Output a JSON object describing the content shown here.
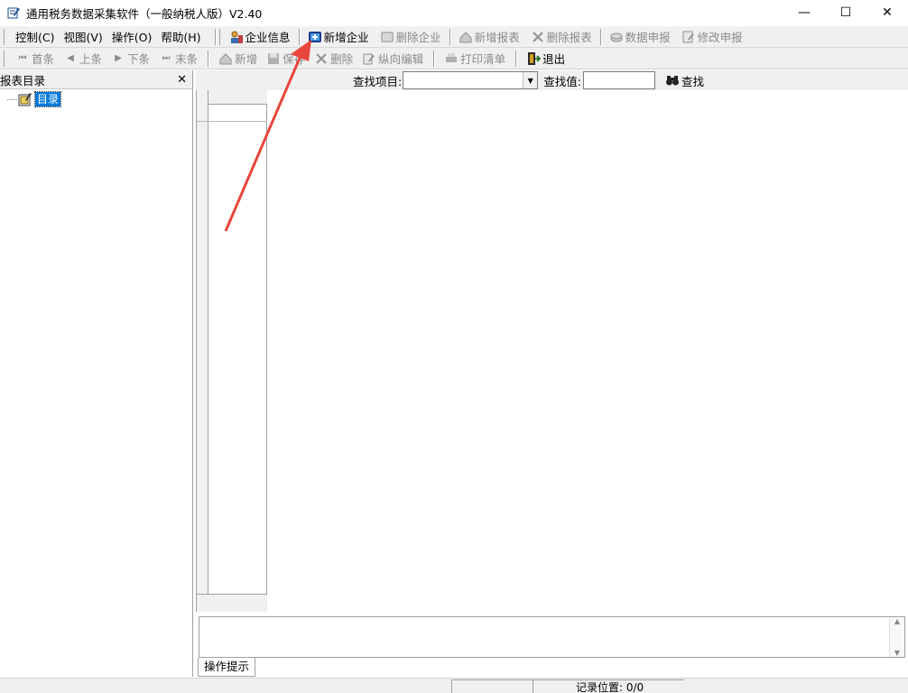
{
  "window": {
    "title": "通用税务数据采集软件（一般纳税人版）V2.40",
    "minimize": "—",
    "maximize": "☐",
    "close": "✕"
  },
  "menu": [
    {
      "label": "控制(C)"
    },
    {
      "label": "视图(V)"
    },
    {
      "label": "操作(O)"
    },
    {
      "label": "帮助(H)"
    }
  ],
  "toolbar1": [
    {
      "label": "企业信息",
      "icon": "enterprise-info-icon",
      "enabled": true
    },
    {
      "label": "新增企业",
      "icon": "add-enterprise-icon",
      "enabled": true
    },
    {
      "label": "删除企业",
      "icon": "delete-enterprise-icon",
      "enabled": false
    },
    {
      "label": "新增报表",
      "icon": "add-report-icon",
      "enabled": false
    },
    {
      "label": "删除报表",
      "icon": "delete-report-icon",
      "enabled": false
    },
    {
      "label": "数据申报",
      "icon": "declare-data-icon",
      "enabled": false
    },
    {
      "label": "修改申报",
      "icon": "modify-declare-icon",
      "enabled": false
    }
  ],
  "toolbar2": [
    {
      "label": "首条",
      "icon": "first-record-icon",
      "enabled": false
    },
    {
      "label": "上条",
      "icon": "prev-record-icon",
      "enabled": false
    },
    {
      "label": "下条",
      "icon": "next-record-icon",
      "enabled": false
    },
    {
      "label": "末条",
      "icon": "last-record-icon",
      "enabled": false
    },
    {
      "label": "新增",
      "icon": "add-icon",
      "enabled": false
    },
    {
      "label": "保存",
      "icon": "save-icon",
      "enabled": false
    },
    {
      "label": "删除",
      "icon": "delete-icon",
      "enabled": false
    },
    {
      "label": "纵向编辑",
      "icon": "vertical-edit-icon",
      "enabled": false
    },
    {
      "label": "打印清单",
      "icon": "print-list-icon",
      "enabled": false
    },
    {
      "label": "退出",
      "icon": "exit-icon",
      "enabled": true
    }
  ],
  "left_panel": {
    "title": "报表目录",
    "close": "✕",
    "tree_root": "目录"
  },
  "search": {
    "item_label": "查找项目:",
    "value_label": "查找值:",
    "button_label": "查找",
    "item_value": "",
    "value": ""
  },
  "bottom": {
    "tab_label": "操作提示"
  },
  "status": {
    "record_position": "记录位置: 0/0"
  },
  "colors": {
    "arrow": "#e8453c",
    "selection": "#0078d7"
  }
}
